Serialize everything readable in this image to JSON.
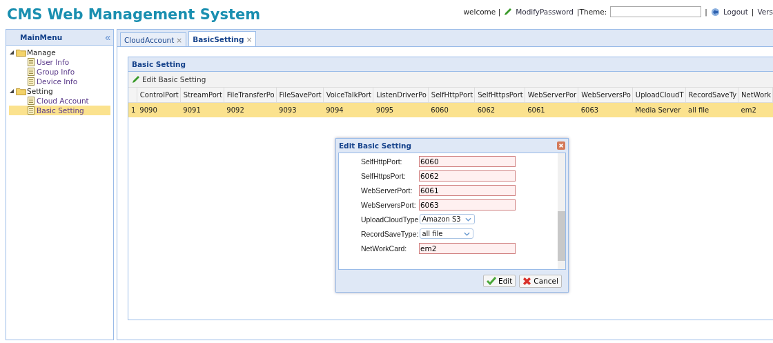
{
  "header": {
    "title": "CMS Web Management System",
    "welcome": "welcome |",
    "modify_password": "ModifyPassword",
    "theme_label": "|Theme:",
    "separator": "|",
    "logout": "Logout",
    "separator_2": "|",
    "version": "Vers"
  },
  "sidebar": {
    "title": "MainMenu",
    "collapse": "«",
    "groups": [
      {
        "label": "Manage",
        "expanded": true,
        "children": [
          {
            "label": "User Info",
            "selected": false
          },
          {
            "label": "Group Info",
            "selected": false
          },
          {
            "label": "Device Info",
            "selected": false
          }
        ]
      },
      {
        "label": "Setting",
        "expanded": true,
        "children": [
          {
            "label": "Cloud Account",
            "selected": false
          },
          {
            "label": "Basic Setting",
            "selected": true
          }
        ]
      }
    ]
  },
  "tabs": [
    {
      "label": "CloudAccount",
      "close": "×",
      "selected": false
    },
    {
      "label": "BasicSetting",
      "close": "×",
      "selected": true
    }
  ],
  "panel": {
    "title": "Basic Setting",
    "toolbar_button": "Edit Basic Setting"
  },
  "table": {
    "columns": [
      "ControlPort",
      "StreamPort",
      "FileTransferPo",
      "FileSavePort",
      "VoiceTalkPort",
      "ListenDriverPo",
      "SelfHttpPort",
      "SelfHttpsPort",
      "WebServerPor",
      "WebServersPo",
      "UploadCloudT",
      "RecordSaveTy",
      "NetWork"
    ],
    "rows": [
      {
        "number": "1",
        "selected": true,
        "cells": [
          "9090",
          "9091",
          "9092",
          "9093",
          "9094",
          "9095",
          "6060",
          "6062",
          "6061",
          "6063",
          "Media Server",
          "all file",
          "em2"
        ]
      }
    ]
  },
  "dialog": {
    "title": "Edit Basic Setting",
    "fields": [
      {
        "kind": "text",
        "label": "SelfHttpPort:",
        "value": "6060"
      },
      {
        "kind": "text",
        "label": "SelfHttpsPort:",
        "value": "6062"
      },
      {
        "kind": "text",
        "label": "WebServerPort:",
        "value": "6061"
      },
      {
        "kind": "text",
        "label": "WebServersPort:",
        "value": "6063"
      },
      {
        "kind": "select",
        "label": "UploadCloudType",
        "value": "Amazon S3"
      },
      {
        "kind": "select",
        "label": "RecordSaveType:",
        "value": "all file"
      },
      {
        "kind": "text",
        "label": "NetWorkCard:",
        "value": "em2"
      }
    ],
    "buttons": [
      "Edit",
      "Cancel"
    ]
  }
}
